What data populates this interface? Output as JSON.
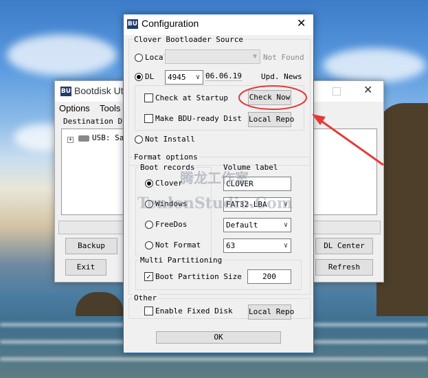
{
  "background_bootdisk": {
    "title": "Bootdisk Uti",
    "menu": [
      "Options",
      "Tools"
    ],
    "destination_label": "Destination Dis",
    "tree_item": "USB: San",
    "buttons": {
      "backup": "Backup",
      "exit": "Exit",
      "dl_center": "DL Center",
      "refresh": "Refresh"
    }
  },
  "dialog": {
    "title": "Configuration",
    "source_group": "Clover Bootloader Source",
    "local_label": "Local",
    "not_found": "Not Found",
    "dl_label": "DL",
    "dl_version": "4945",
    "dl_date": "06.06.19",
    "upd_news": "Upd. News",
    "check_startup": "Check at Startup",
    "check_now": "Check Now",
    "make_bdu": "Make BDU-ready Dist",
    "local_repo": "Local Repo",
    "not_install": "Not Install",
    "format_group": "Format options",
    "boot_records": "Boot records",
    "volume_label": "Volume label",
    "volume_value": "CLOVER",
    "records": [
      "Clover",
      "Windows",
      "FreeDos",
      "Not Format"
    ],
    "fs_value": "FAT32-LBA",
    "align_value": "Default",
    "size_value": "63",
    "multi_group": "Multi Partitioning",
    "boot_partition": "Boot Partition Size (M",
    "boot_partition_value": "200",
    "other_group": "Other",
    "enable_fixed": "Enable Fixed Disk",
    "other_local_repo": "Local Repo",
    "ok": "OK"
  },
  "watermark": {
    "cn": "腾龙工作室",
    "en": "TenlonStudio.Com"
  },
  "colors": {
    "accent_border": "#1a73c8",
    "annotation": "#e53935"
  }
}
